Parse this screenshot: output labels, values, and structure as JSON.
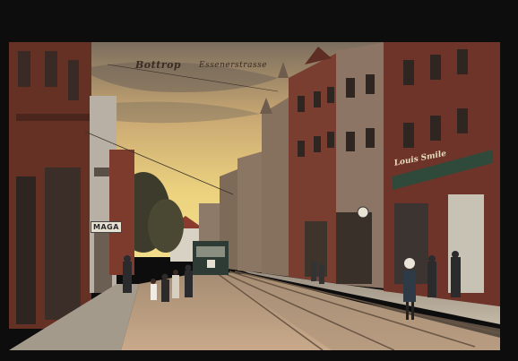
{
  "caption": {
    "city": "Bottrop",
    "street": "Essenerstrasse"
  },
  "signs": {
    "left_shop": "MAGA",
    "right_shop": "Louis Smile"
  },
  "colors": {
    "frame": "#0d0d0d",
    "sky_top": "#8a7a66",
    "sky_glow": "#e8c878",
    "street": "#b89c7c",
    "brick": "#7a3a2a"
  }
}
